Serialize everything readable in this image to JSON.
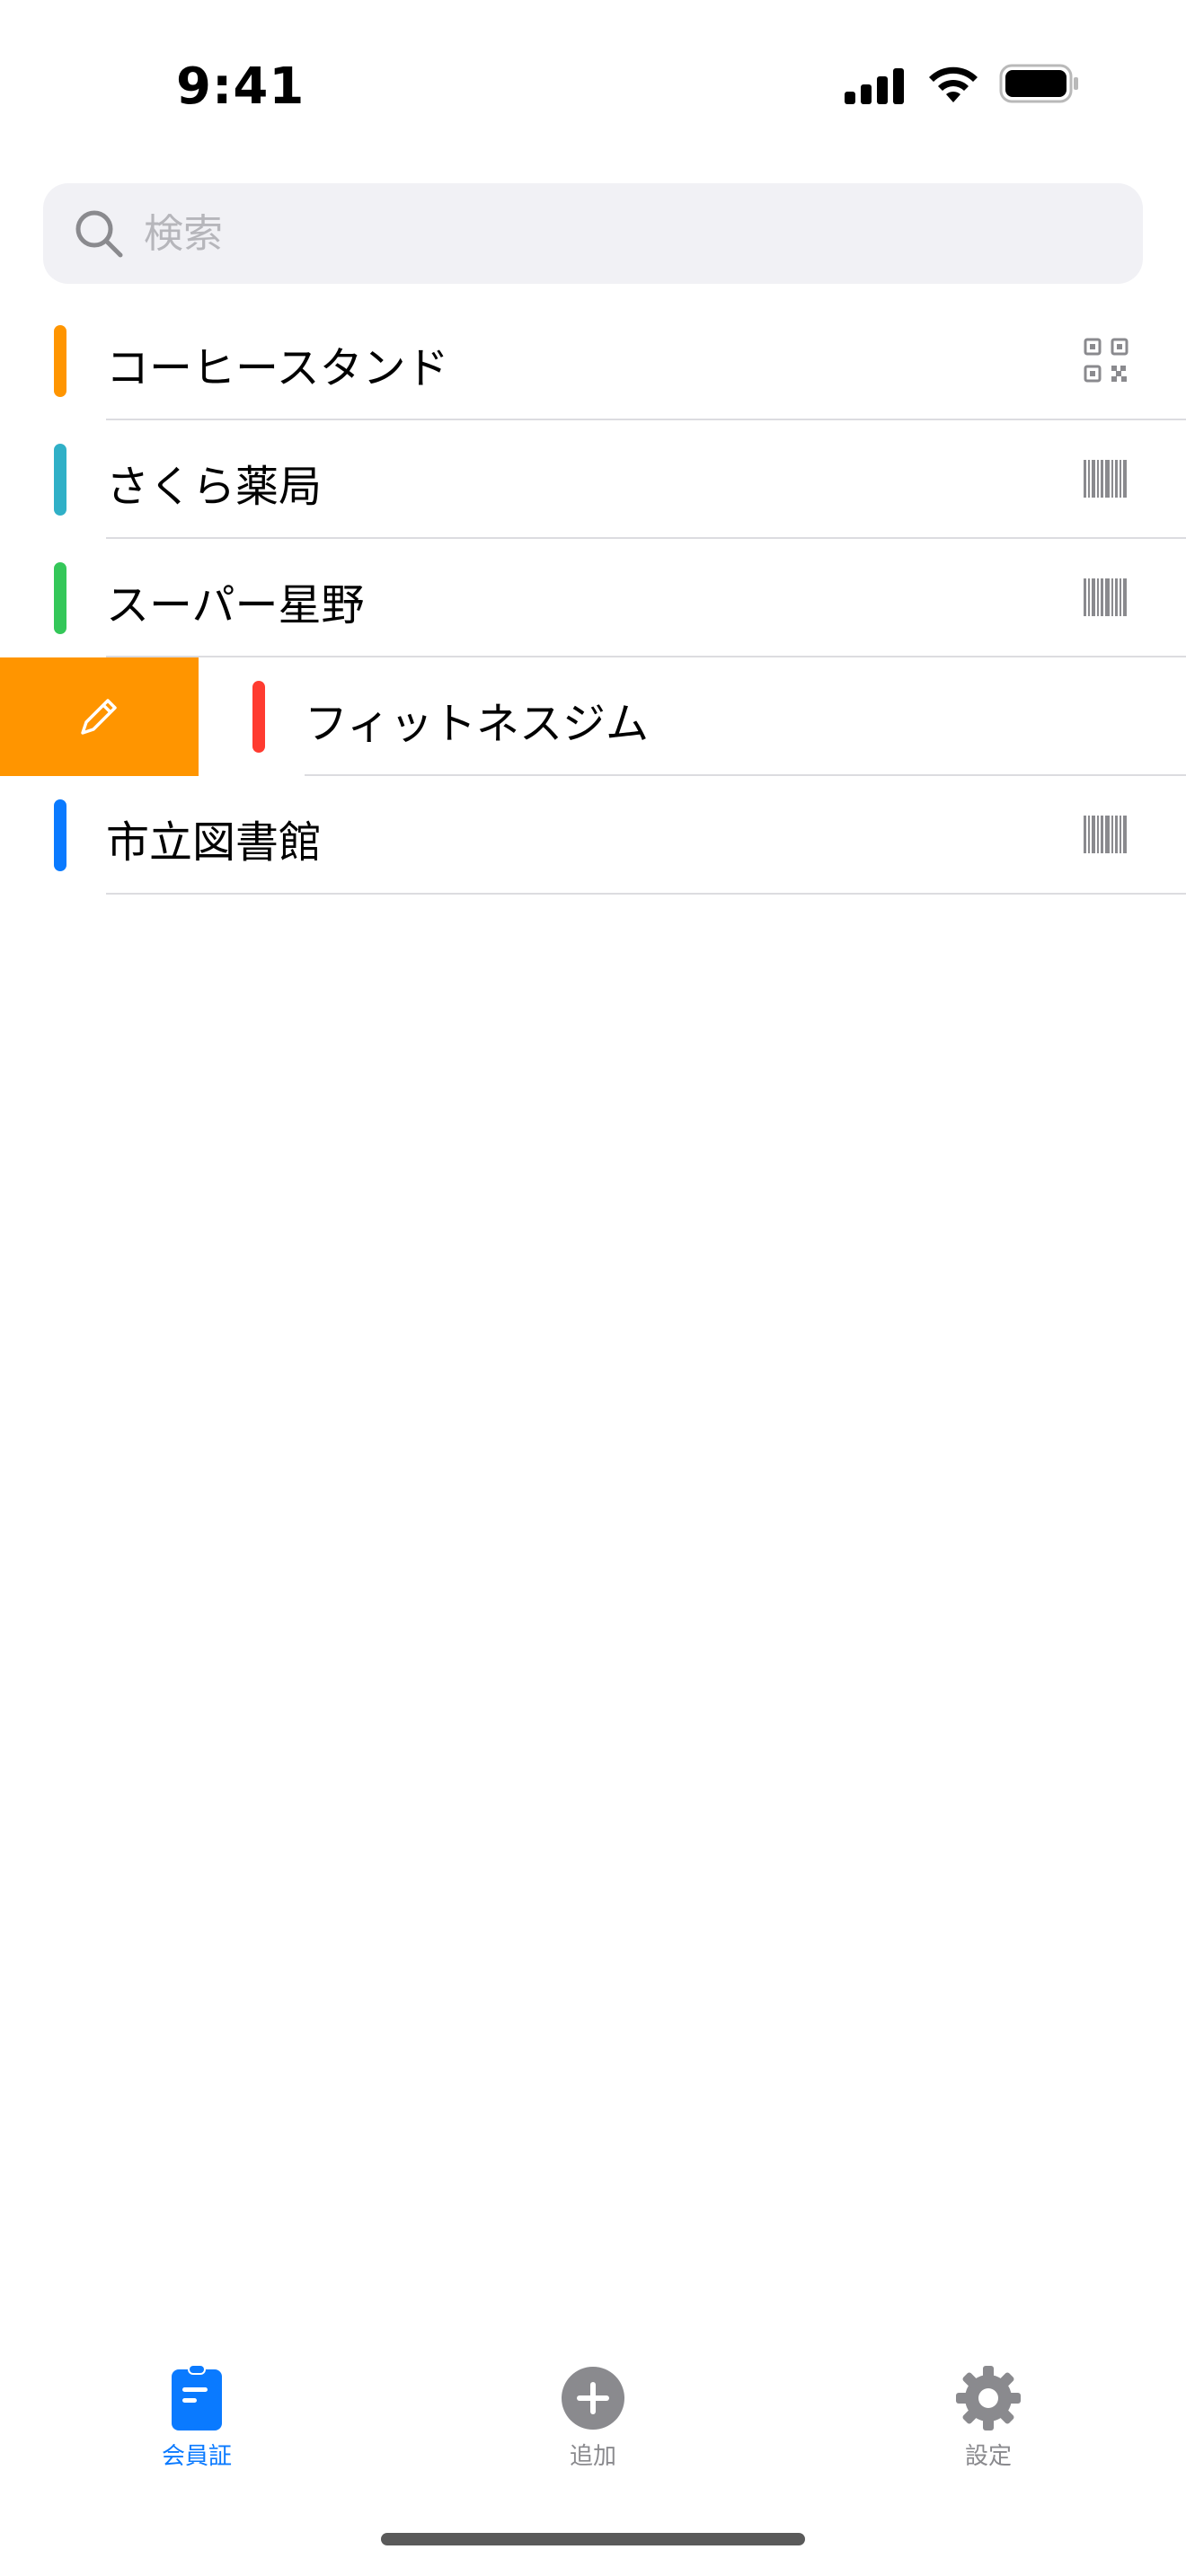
{
  "status_bar": {
    "time": "9:41",
    "icons": [
      "signal-icon",
      "wifi-icon",
      "battery-icon"
    ]
  },
  "search": {
    "placeholder": "検索",
    "value": ""
  },
  "cards": [
    {
      "name": "コーヒースタンド",
      "color": "#ff9500",
      "code_type": "qr-code-icon"
    },
    {
      "name": "さくら薬局",
      "color": "#30b0c7",
      "code_type": "barcode-icon"
    },
    {
      "name": "スーパー星野",
      "color": "#34c759",
      "code_type": "barcode-icon"
    },
    {
      "name": "フィットネスジム",
      "color": "#ff3b30",
      "code_type": "",
      "swiped": true
    },
    {
      "name": "市立図書館",
      "color": "#0a7aff",
      "code_type": "barcode-icon"
    }
  ],
  "swipe_action": {
    "icon": "pencil-icon",
    "color": "#ff9500"
  },
  "tab_bar": {
    "tabs": [
      {
        "label": "会員証",
        "icon": "membership-card-icon",
        "active": true
      },
      {
        "label": "追加",
        "icon": "plus-circle-icon",
        "active": false
      },
      {
        "label": "設定",
        "icon": "gear-icon",
        "active": false
      }
    ],
    "active_color": "#0a7aff",
    "inactive_color": "#8a8a8e"
  }
}
